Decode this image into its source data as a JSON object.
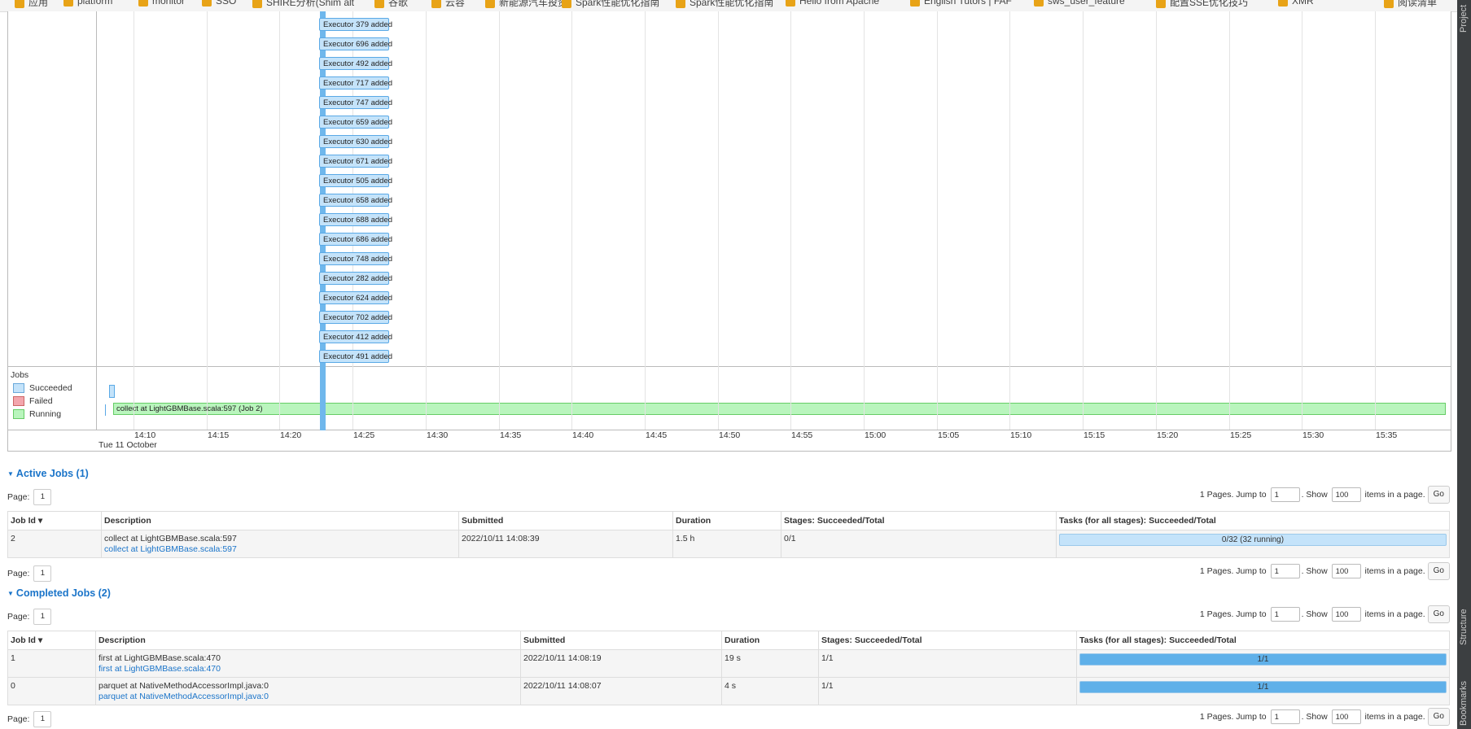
{
  "bookmarks_bar": {
    "items": [
      "应用",
      "platform",
      "monitor",
      "SSO",
      "SHIRE分析(Shim alt",
      "谷歌",
      "云容",
      "新能源汽车投资",
      "Spark性能优化指南",
      "Spark性能优化指南",
      "Hello from Apache",
      "English Tutors | FAF",
      "sws_user_feature",
      "配置SSE优化技巧",
      "XMR",
      "阅读清单"
    ]
  },
  "ide_side": {
    "project": "Project",
    "structure": "Structure",
    "bookmarks": "Bookmarks"
  },
  "timeline": {
    "executors": [
      "Executor 379 added",
      "Executor 696 added",
      "Executor 492 added",
      "Executor 717 added",
      "Executor 747 added",
      "Executor 659 added",
      "Executor 630 added",
      "Executor 671 added",
      "Executor 505 added",
      "Executor 658 added",
      "Executor 688 added",
      "Executor 686 added",
      "Executor 748 added",
      "Executor 282 added",
      "Executor 624 added",
      "Executor 702 added",
      "Executor 412 added",
      "Executor 491 added"
    ],
    "jobs_legend": {
      "title": "Jobs",
      "succeeded": "Succeeded",
      "failed": "Failed",
      "running": "Running"
    },
    "running_job_label": "collect at LightGBMBase.scala:597 (Job 2)",
    "ticks": [
      "14:10",
      "14:15",
      "14:20",
      "14:25",
      "14:30",
      "14:35",
      "14:40",
      "14:45",
      "14:50",
      "14:55",
      "15:00",
      "15:05",
      "15:10",
      "15:15",
      "15:20",
      "15:25",
      "15:30",
      "15:35"
    ],
    "date": "Tue 11 October",
    "colors": {
      "succeeded": "#c4e3fa",
      "failed": "#f3a6ad",
      "running": "#b9f5bd",
      "now_line": "#6fb7ec"
    }
  },
  "pager": {
    "page_label": "Page:",
    "page_value": "1",
    "pages_text": "1 Pages. Jump to",
    "jump_value": "1",
    "show_text": ". Show",
    "show_value": "100",
    "items_text": "items in a page.",
    "go_label": "Go"
  },
  "active_jobs": {
    "title": "Active Jobs (1)",
    "headers": [
      "Job Id ▾",
      "Description",
      "Submitted",
      "Duration",
      "Stages: Succeeded/Total",
      "Tasks (for all stages): Succeeded/Total"
    ],
    "rows": [
      {
        "job_id": "2",
        "desc": "collect at LightGBMBase.scala:597",
        "desc_link": "collect at LightGBMBase.scala:597",
        "submitted": "2022/10/11 14:08:39",
        "duration": "1.5 h",
        "stages": "0/1",
        "tasks_text": "0/32 (32 running)",
        "tasks_progress": 0
      }
    ]
  },
  "completed_jobs": {
    "title": "Completed Jobs (2)",
    "headers": [
      "Job Id ▾",
      "Description",
      "Submitted",
      "Duration",
      "Stages: Succeeded/Total",
      "Tasks (for all stages): Succeeded/Total"
    ],
    "rows": [
      {
        "job_id": "1",
        "desc": "first at LightGBMBase.scala:470",
        "desc_link": "first at LightGBMBase.scala:470",
        "submitted": "2022/10/11 14:08:19",
        "duration": "19 s",
        "stages": "1/1",
        "tasks_text": "1/1",
        "tasks_progress": 1
      },
      {
        "job_id": "0",
        "desc": "parquet at NativeMethodAccessorImpl.java:0",
        "desc_link": "parquet at NativeMethodAccessorImpl.java:0",
        "submitted": "2022/10/11 14:08:07",
        "duration": "4 s",
        "stages": "1/1",
        "tasks_text": "1/1",
        "tasks_progress": 1
      }
    ]
  }
}
